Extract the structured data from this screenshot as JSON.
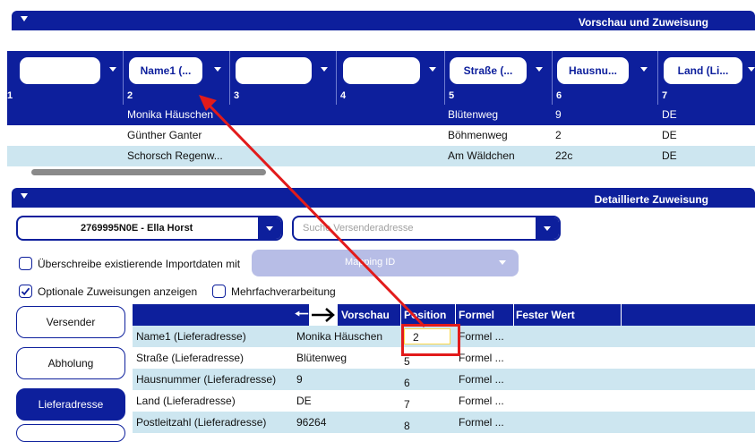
{
  "preview": {
    "title": "Vorschau und Zuweisung",
    "columns": [
      {
        "label": "",
        "number": "1"
      },
      {
        "label": "Name1 (...",
        "number": "2"
      },
      {
        "label": "",
        "number": "3"
      },
      {
        "label": "",
        "number": "4"
      },
      {
        "label": "Straße (...",
        "number": "5"
      },
      {
        "label": "Hausnu...",
        "number": "6"
      },
      {
        "label": "Land (Li...",
        "number": "7"
      }
    ],
    "rows": [
      {
        "name": "Monika Häuschen",
        "street": "Blütenweg",
        "house": "9",
        "country": "DE"
      },
      {
        "name": "Günther Ganter",
        "street": "Böhmenweg",
        "house": "2",
        "country": "DE"
      },
      {
        "name": "Schorsch Regenw...",
        "street": "Am Wäldchen",
        "house": "22c",
        "country": "DE"
      }
    ]
  },
  "details": {
    "title": "Detaillierte Zuweisung",
    "customer_select": "2769995N0E - Ella Horst",
    "sender_search_placeholder": "Suche Versenderadresse",
    "overwrite_label": "Überschreibe existierende Importdaten mit",
    "mapping_placeholder": "Mapping ID",
    "optional_label": "Optionale Zuweisungen anzeigen",
    "multi_label": "Mehrfachverarbeitung"
  },
  "sidebar": {
    "items": [
      {
        "label": "Versender"
      },
      {
        "label": "Abholung"
      },
      {
        "label": "Lieferadresse"
      },
      {
        "label": ""
      }
    ]
  },
  "grid": {
    "headers": {
      "preview": "Vorschau",
      "position": "Position",
      "formula": "Formel",
      "fixed": "Fester Wert"
    },
    "rows": [
      {
        "field": "Name1 (Lieferadresse)",
        "preview": "Monika Häuschen",
        "position": "2",
        "formula": "Formel ..."
      },
      {
        "field": "Straße (Lieferadresse)",
        "preview": "Blütenweg",
        "position": "5",
        "formula": "Formel ..."
      },
      {
        "field": "Hausnummer (Lieferadresse)",
        "preview": "9",
        "position": "6",
        "formula": "Formel ..."
      },
      {
        "field": "Land (Lieferadresse)",
        "preview": "DE",
        "position": "7",
        "formula": "Formel ..."
      },
      {
        "field": "Postleitzahl (Lieferadresse)",
        "preview": "96264",
        "position": "8",
        "formula": "Formel ..."
      }
    ]
  },
  "colors": {
    "primary": "#0d1f9c",
    "selected_row": "#0d1f9c",
    "alt_row": "#cde6f0",
    "highlight": "#e21b1b"
  }
}
